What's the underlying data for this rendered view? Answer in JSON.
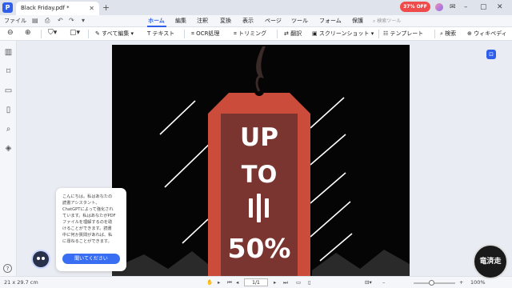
{
  "titlebar": {
    "doc_tab": "Black Friday.pdf *",
    "promo": "37% OFF"
  },
  "menubar": {
    "file": "ファイル",
    "items": [
      "ホーム",
      "編集",
      "注釈",
      "変換",
      "表示",
      "ページ",
      "ツール",
      "フォーム",
      "保護"
    ],
    "search_placeholder": "検索ツール"
  },
  "toolbar": {
    "edit_all": "すべて編集",
    "text": "テキスト",
    "ocr": "OCR処理",
    "crop": "トリミング",
    "translate": "翻訳",
    "screenshot": "スクリーンショット",
    "template": "テンプレート",
    "search": "検索",
    "wiki": "ウィキペディ"
  },
  "document": {
    "line1": "UP",
    "line2": "TO",
    "line3": "50%"
  },
  "chat": {
    "message": "こんにちは。私はあなたの\n読書アシスタント、\nChatGPTによって強化され\nています。私はあなたがPDF\nファイルを理解するのを助\nけることができます。読書\n中に何か質問があれば、私\nに尋ねることができます。",
    "button": "聞いてください"
  },
  "statusbar": {
    "page_size": "21 x 29.7 cm",
    "page_indicator": "1/1",
    "zoom": "100%"
  },
  "watermark": "竜済走",
  "colors": {
    "accent": "#2f5fe8",
    "tag_red": "#cc4c3b",
    "tag_inner": "#7a3530"
  }
}
